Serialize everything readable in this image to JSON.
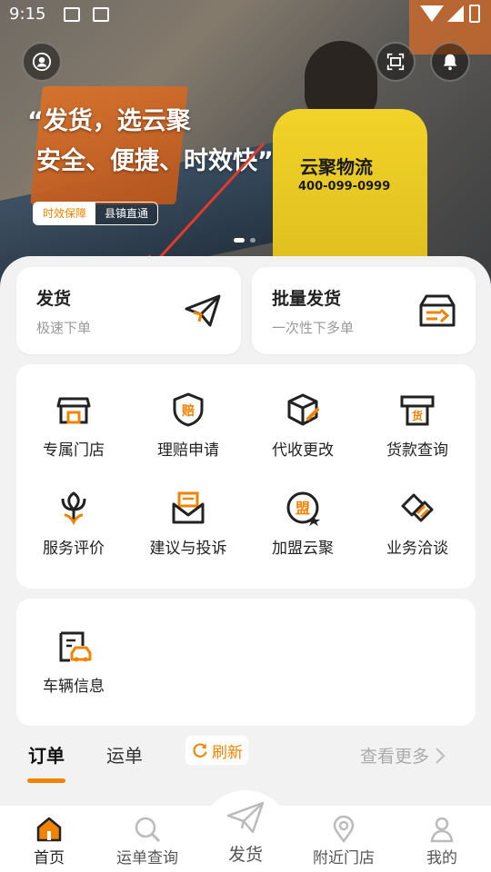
{
  "status_bar": {
    "time": "9:15"
  },
  "hero": {
    "slogan_line1": "“发货，选云聚",
    "slogan_line2": "安全、便捷、时效快”",
    "tag_primary": "时效保障",
    "tag_secondary": "县镇直通",
    "vest_brand": "云聚物流",
    "vest_phone": "400-099-0999",
    "slide_count": 2,
    "active_slide": 0
  },
  "quick_actions": {
    "ship": {
      "title": "发货",
      "subtitle": "极速下单",
      "icon": "paper-plane-icon"
    },
    "bulk": {
      "title": "批量发货",
      "subtitle": "一次性下多单",
      "icon": "box-arrow-icon"
    }
  },
  "services": [
    {
      "label": "专属门店",
      "icon": "store-icon"
    },
    {
      "label": "理赔申请",
      "icon": "claim-shield-icon"
    },
    {
      "label": "代收更改",
      "icon": "package-edit-icon"
    },
    {
      "label": "货款查询",
      "icon": "payment-receipt-icon"
    },
    {
      "label": "服务评价",
      "icon": "flower-rating-icon"
    },
    {
      "label": "建议与投诉",
      "icon": "mail-feedback-icon"
    },
    {
      "label": "加盟云聚",
      "icon": "join-badge-icon"
    },
    {
      "label": "业务洽谈",
      "icon": "handshake-icon"
    }
  ],
  "vehicle": {
    "label": "车辆信息",
    "icon": "vehicle-clipboard-icon"
  },
  "order_tabs": {
    "tabs": [
      "订单",
      "运单"
    ],
    "active": 0,
    "refresh_label": "刷新",
    "more_label": "查看更多"
  },
  "bottom_nav": {
    "items": [
      {
        "label": "首页",
        "icon": "home-icon",
        "active": true
      },
      {
        "label": "运单查询",
        "icon": "search-icon",
        "active": false
      },
      {
        "label": "发货",
        "icon": "paper-plane-icon",
        "active": false
      },
      {
        "label": "附近门店",
        "icon": "location-pin-icon",
        "active": false
      },
      {
        "label": "我的",
        "icon": "user-icon",
        "active": false
      }
    ]
  },
  "colors": {
    "accent": "#f08300",
    "arrow": "#e23b2e",
    "sheet_bg": "#f2f2f2"
  }
}
